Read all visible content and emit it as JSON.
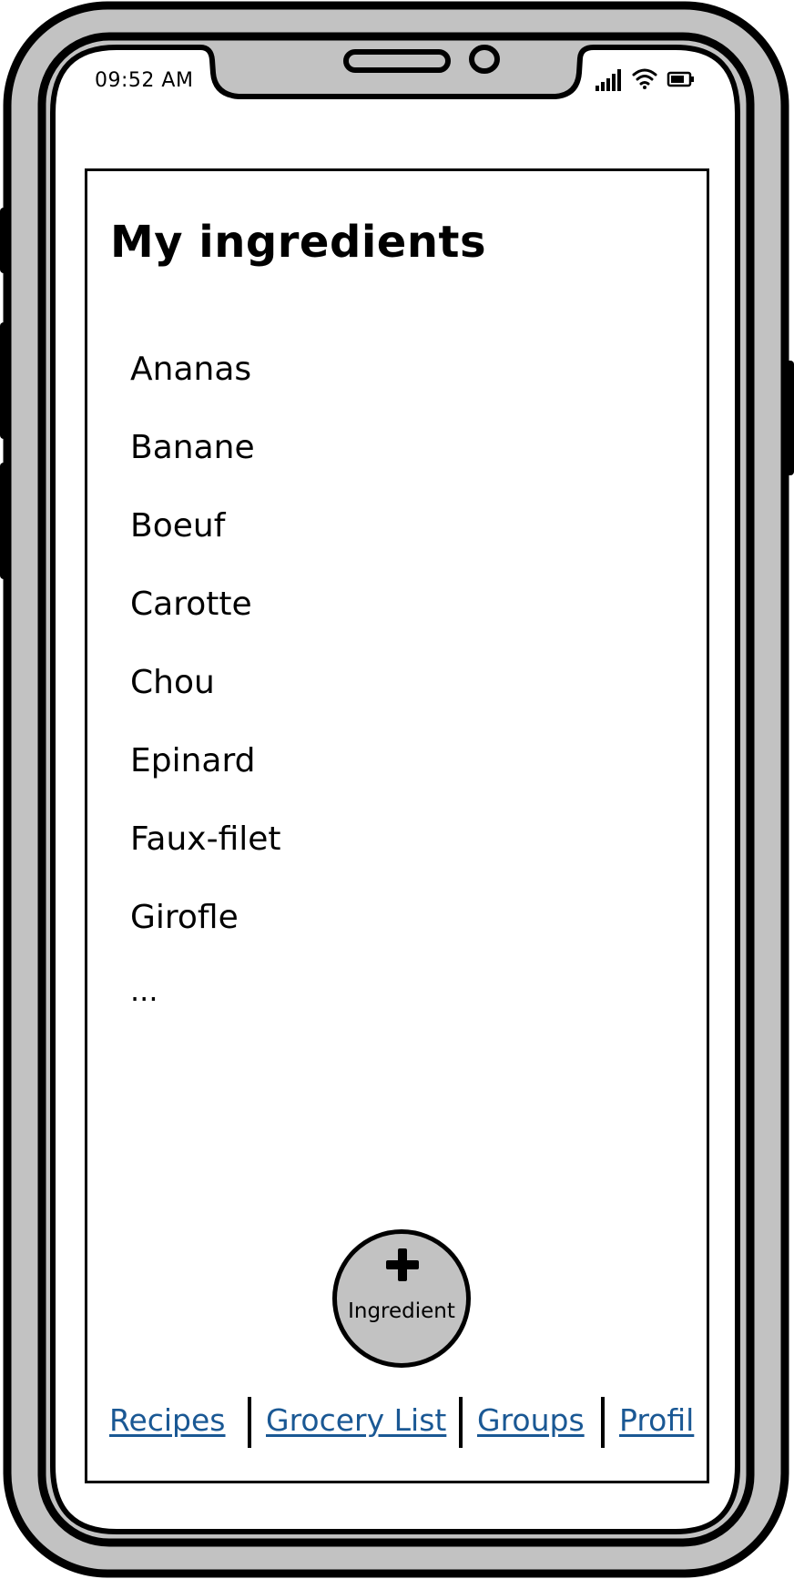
{
  "status_bar": {
    "time": "09:52 AM",
    "icons": [
      "signal-icon",
      "wifi-icon",
      "battery-icon"
    ]
  },
  "page": {
    "title": "My ingredients"
  },
  "ingredients": {
    "items": [
      "Ananas",
      "Banane",
      "Boeuf",
      "Carotte",
      "Chou",
      "Epinard",
      "Faux-filet",
      "Girofle"
    ],
    "more": "..."
  },
  "add_button": {
    "icon": "plus-icon",
    "label": "Ingredient"
  },
  "bottom_nav": {
    "items": [
      {
        "label": "Recipes"
      },
      {
        "label": "Grocery List"
      },
      {
        "label": "Groups"
      },
      {
        "label": "Profil"
      }
    ]
  },
  "colors": {
    "frame": "#c2c2c2",
    "outline": "#000000",
    "link": "#1a5894",
    "button_fill": "#c2c2c2"
  }
}
